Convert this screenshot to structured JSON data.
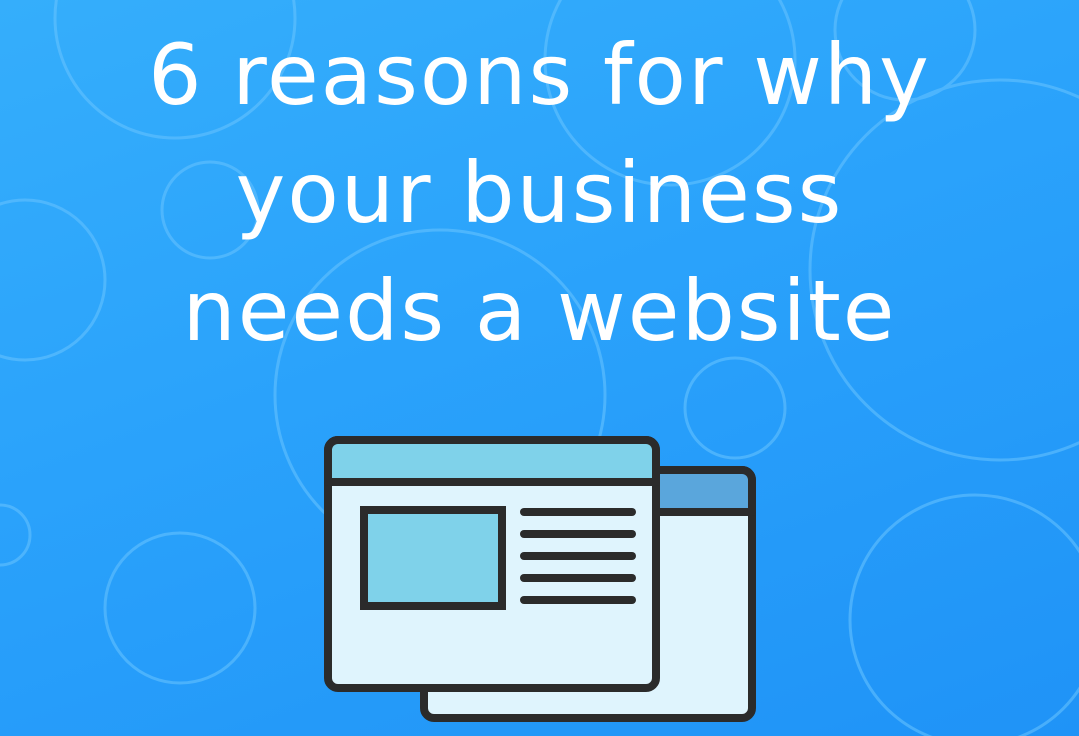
{
  "headline": {
    "lines": [
      "6 reasons for why",
      "your business",
      "needs a website"
    ]
  },
  "colors": {
    "background": "#2aa2fb",
    "text": "#ffffff",
    "window_fill": "#dff4fd",
    "window_header_front": "#7fd2ea",
    "window_header_back": "#5aa6dc",
    "image_block": "#7fd2ea",
    "outline": "#2b2b2b",
    "circles": "#6cc6ff"
  },
  "illustration": {
    "icon": "browser-windows-icon"
  }
}
